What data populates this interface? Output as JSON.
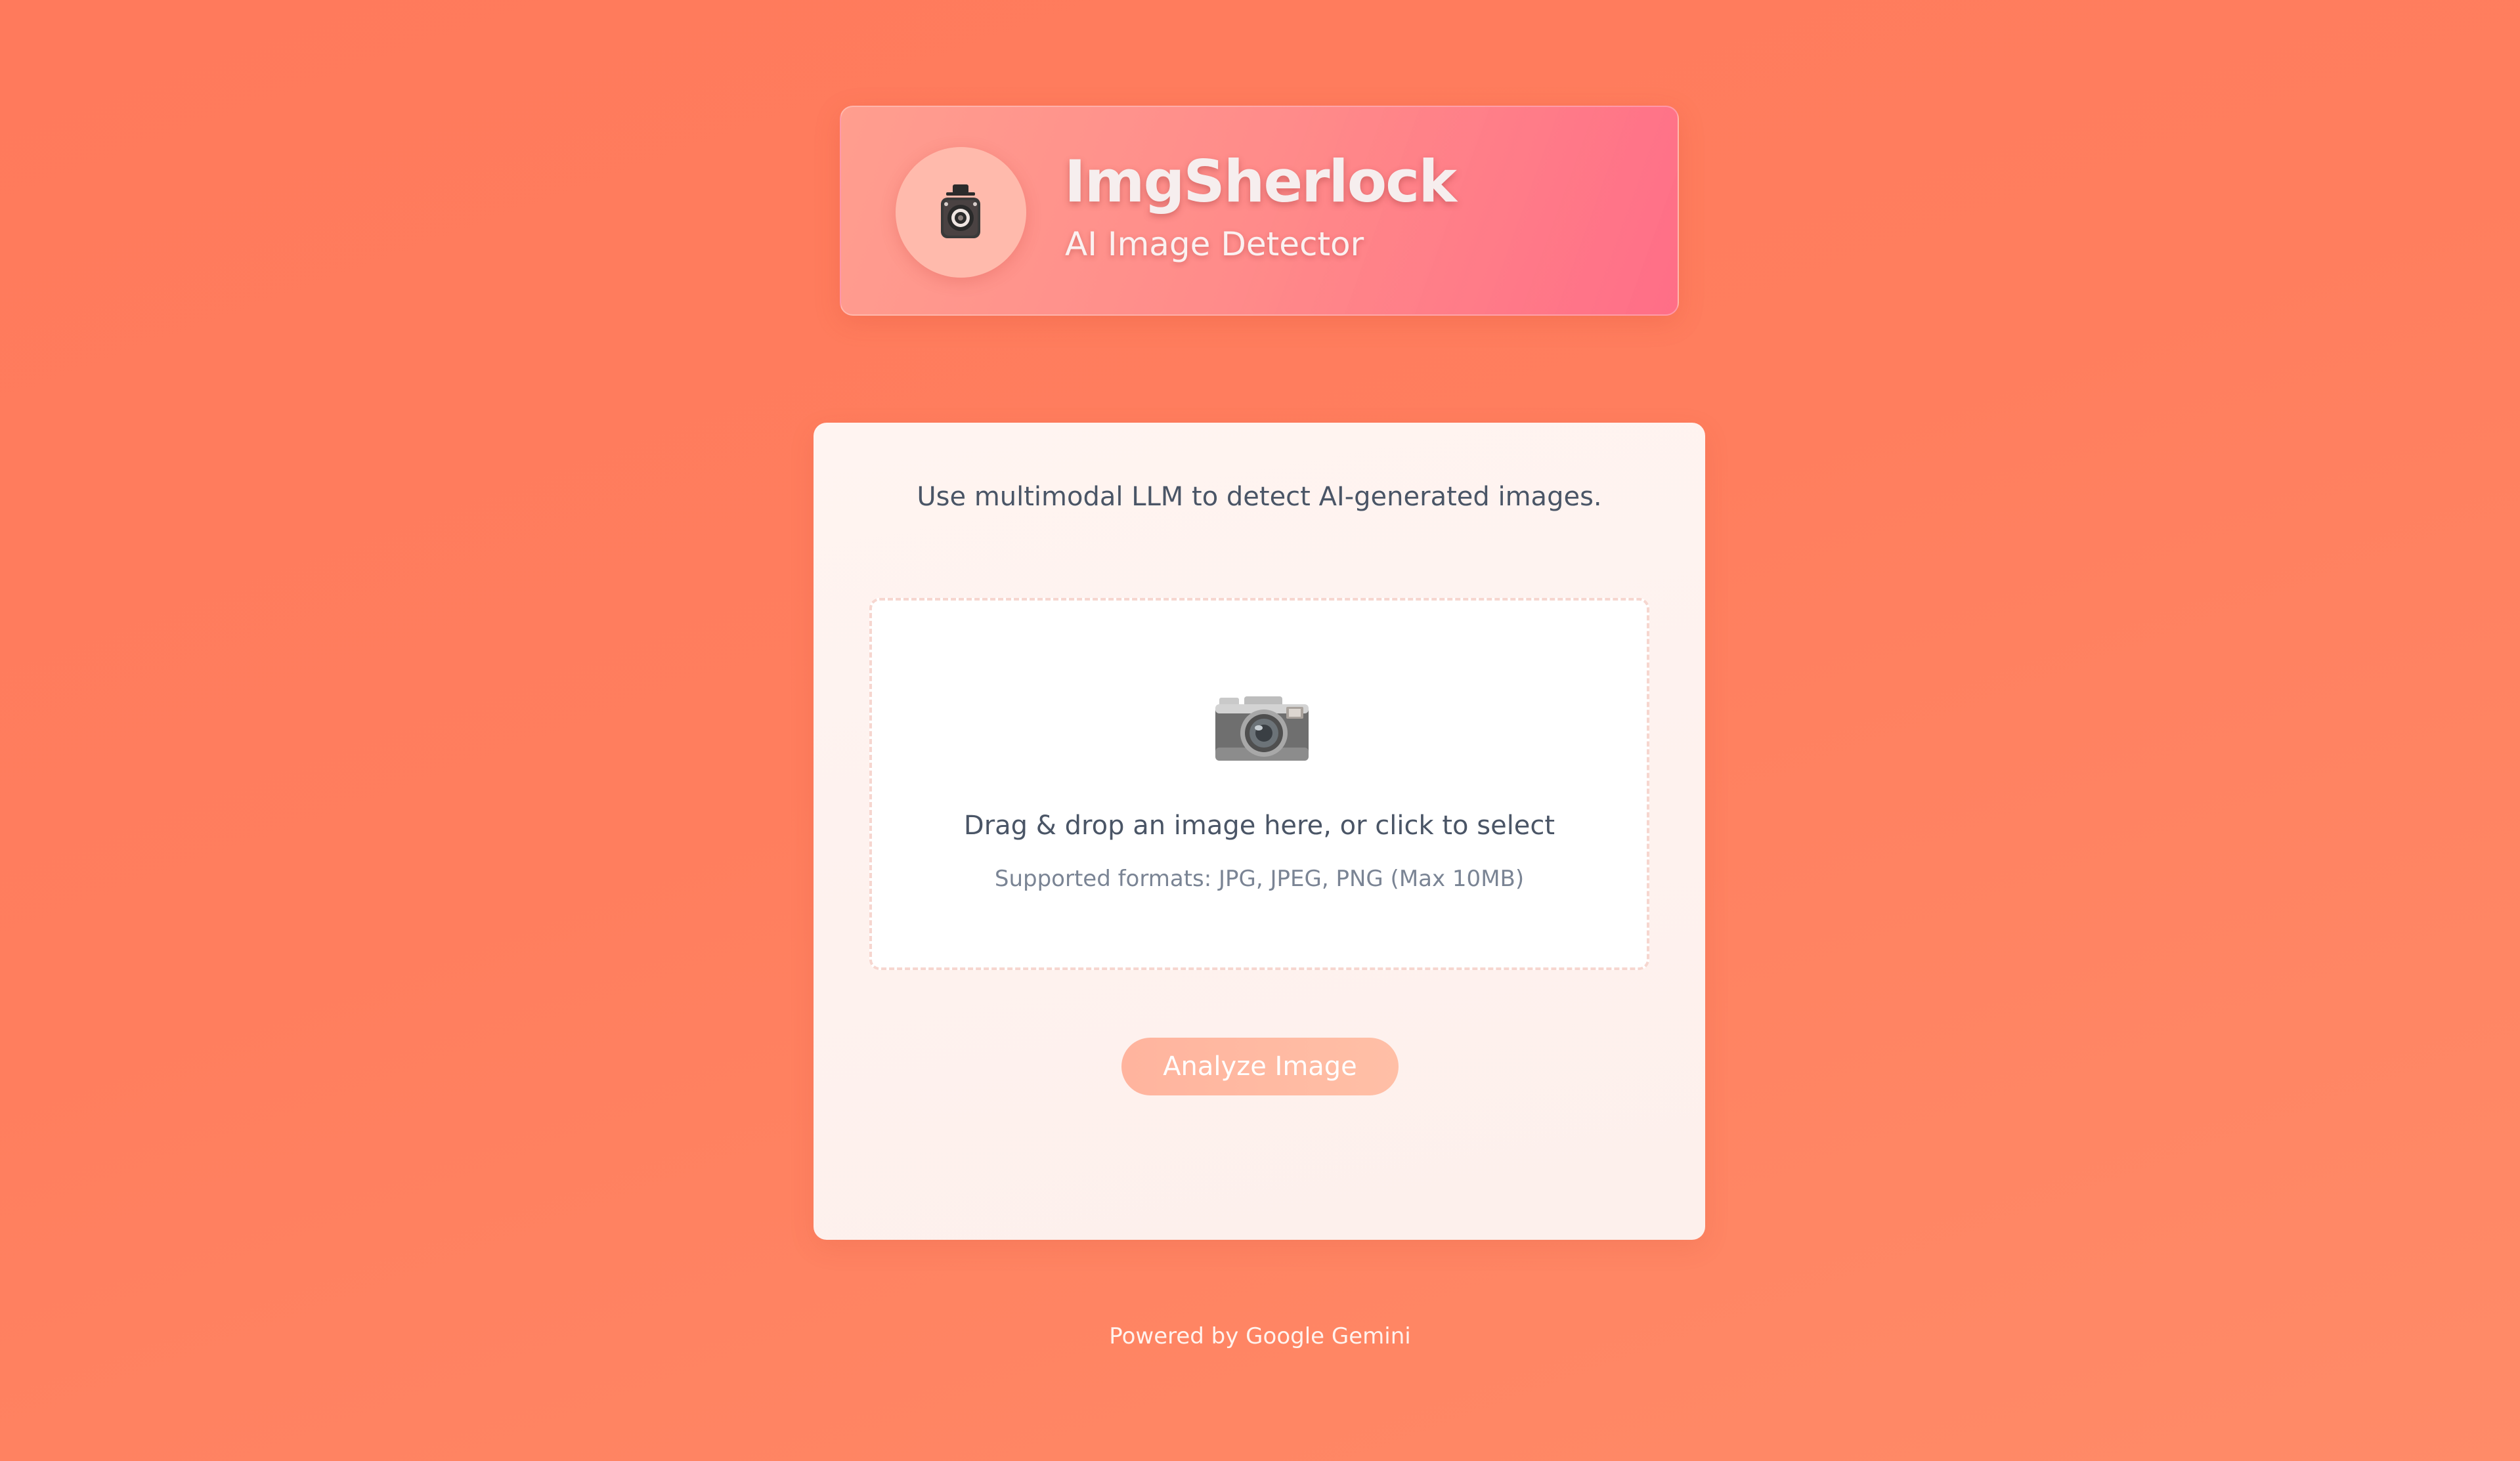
{
  "header": {
    "logo_icon": "detective-camera-icon",
    "title": "ImgSherlock",
    "subtitle": "AI Image Detector"
  },
  "main": {
    "intro": "Use multimodal LLM to detect AI-generated images.",
    "dropzone": {
      "icon": "camera-icon",
      "text": "Drag & drop an image here, or click to select",
      "hint": "Supported formats: JPG, JPEG, PNG (Max 10MB)"
    },
    "analyze_label": "Analyze Image"
  },
  "footer": {
    "text": "Powered by Google Gemini"
  },
  "colors": {
    "background": "#ff7e5e",
    "accent": "#ff8a75",
    "button": "#ffb9a2"
  }
}
